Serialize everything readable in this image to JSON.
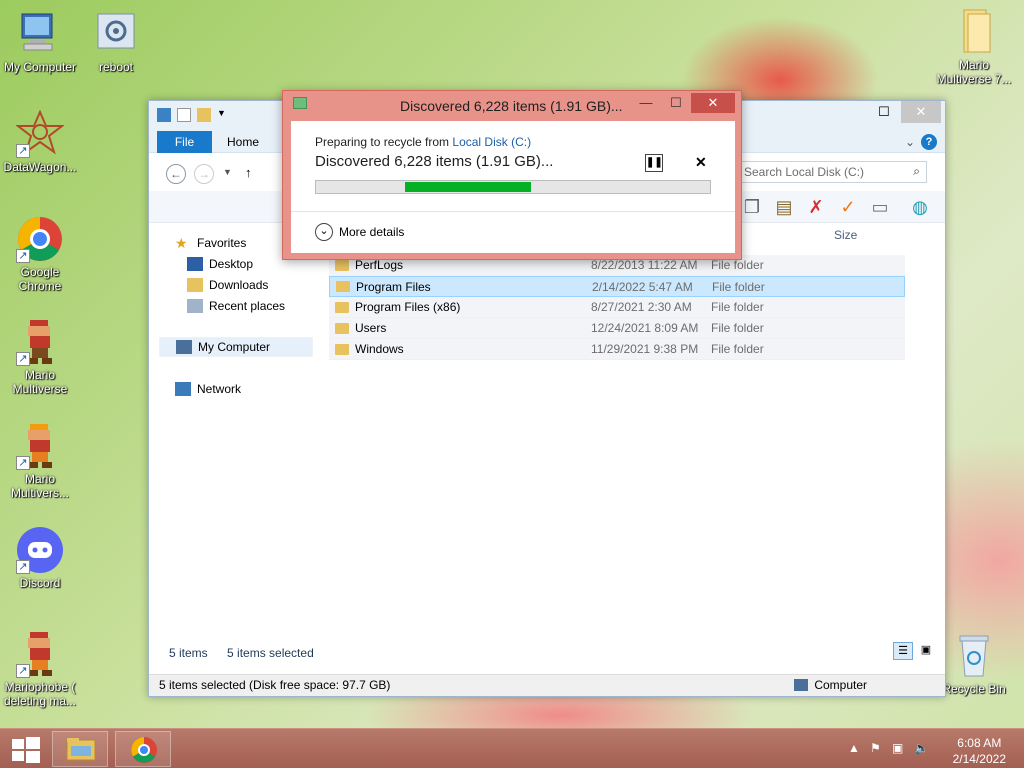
{
  "desktop": {
    "icons": [
      {
        "label": "My Computer",
        "icon": "computer-icon"
      },
      {
        "label": "reboot",
        "icon": "reboot-icon"
      },
      {
        "label": "DataWagon...",
        "icon": "datawagon-icon"
      },
      {
        "label": "Google Chrome",
        "icon": "chrome-icon"
      },
      {
        "label": "Mario Multiverse",
        "icon": "mario-icon"
      },
      {
        "label": "Mario Multivers...",
        "icon": "mario-icon"
      },
      {
        "label": "Discord",
        "icon": "discord-icon"
      },
      {
        "label": "Mariophobe ( deleting ma...",
        "icon": "mario-icon"
      },
      {
        "label": "Mario Multiverse 7...",
        "icon": "folder-icon"
      },
      {
        "label": "Recycle Bin",
        "icon": "recycle-bin-icon"
      }
    ]
  },
  "explorer": {
    "tabs": {
      "file": "File",
      "home": "Home"
    },
    "search_placeholder": "Search Local Disk (C:)",
    "columns": {
      "size": "Size"
    },
    "nav": {
      "favorites": "Favorites",
      "desktop": "Desktop",
      "downloads": "Downloads",
      "recent": "Recent places",
      "computer": "My Computer",
      "network": "Network"
    },
    "rows": [
      {
        "name": "PerfLogs",
        "date": "8/22/2013 11:22 AM",
        "type": "File folder"
      },
      {
        "name": "Program Files",
        "date": "2/14/2022 5:47 AM",
        "type": "File folder"
      },
      {
        "name": "Program Files (x86)",
        "date": "8/27/2021 2:30 AM",
        "type": "File folder"
      },
      {
        "name": "Users",
        "date": "12/24/2021 8:09 AM",
        "type": "File folder"
      },
      {
        "name": "Windows",
        "date": "11/29/2021 9:38 PM",
        "type": "File folder"
      }
    ],
    "status_count": "5 items",
    "status_selected": "5 items selected",
    "statusbar_text": "5 items selected (Disk free space: 97.7 GB)",
    "statusbar_location": "Computer"
  },
  "dialog": {
    "title": "Discovered 6,228 items (1.91 GB)...",
    "sub_prefix": "Preparing to recycle from",
    "sub_link": "Local Disk (C:)",
    "main": "Discovered 6,228 items (1.91 GB)...",
    "more_details": "More details",
    "progress": {
      "start": 0.225,
      "end": 0.545
    },
    "progress_color": "#06b025"
  },
  "taskbar": {
    "time": "6:08 AM",
    "date": "2/14/2022"
  },
  "colors": {
    "accent": "#1979ca",
    "dialog_frame": "#e8938a",
    "taskbar": "#a35f52"
  }
}
